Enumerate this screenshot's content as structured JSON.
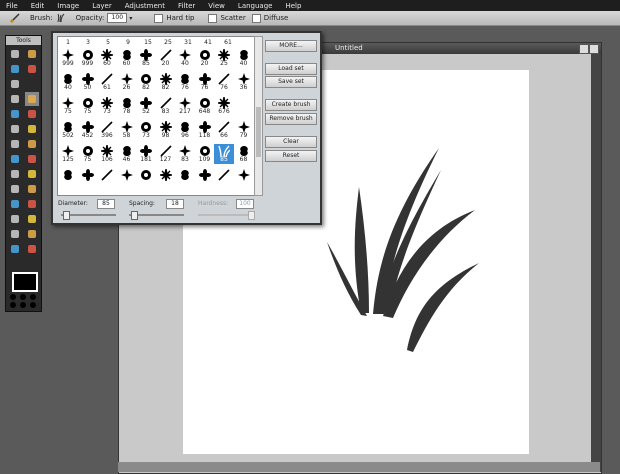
{
  "menu": [
    "File",
    "Edit",
    "Image",
    "Layer",
    "Adjustment",
    "Filter",
    "View",
    "Language",
    "Help"
  ],
  "toolbar": {
    "brush_label": "Brush:",
    "opacity_label": "Opacity:",
    "opacity_value": "100",
    "hard_tip": "Hard tip",
    "scatter": "Scatter",
    "diffuse": "Diffuse"
  },
  "tools_title": "Tools",
  "document": {
    "title": "Untitled"
  },
  "brush_panel": {
    "top_row": [
      "1",
      "3",
      "5",
      "9",
      "15",
      "25",
      "31",
      "41",
      "61"
    ],
    "rows": [
      [
        "999",
        "999",
        "60",
        "60",
        "85",
        "20",
        "40",
        "20",
        "25",
        "40"
      ],
      [
        "40",
        "50",
        "61",
        "26",
        "82",
        "82",
        "76",
        "76",
        "76",
        "36"
      ],
      [
        "75",
        "75",
        "73",
        "78",
        "52",
        "83",
        "217",
        "648",
        "676"
      ],
      [
        "502",
        "452",
        "396",
        "58",
        "73",
        "98",
        "96",
        "118",
        "66",
        "79"
      ],
      [
        "125",
        "75",
        "106",
        "46",
        "181",
        "127",
        "83",
        "109",
        "85",
        "68"
      ],
      [
        "",
        "",
        "",
        "",
        "",
        "",
        "",
        "",
        "",
        ""
      ]
    ],
    "selected": "85",
    "buttons": [
      "MORE...",
      "Load set",
      "Save set",
      "Create brush",
      "Remove brush",
      "Clear",
      "Reset"
    ],
    "diameter_label": "Diameter:",
    "diameter_value": "85",
    "spacing_label": "Spacing:",
    "spacing_value": "18",
    "hardness_label": "Hardness:",
    "hardness_value": "100"
  },
  "colors": {
    "accent": "#3a8fd8",
    "menubar": "#1e1e1e",
    "workspace": "#5a5a5a"
  }
}
